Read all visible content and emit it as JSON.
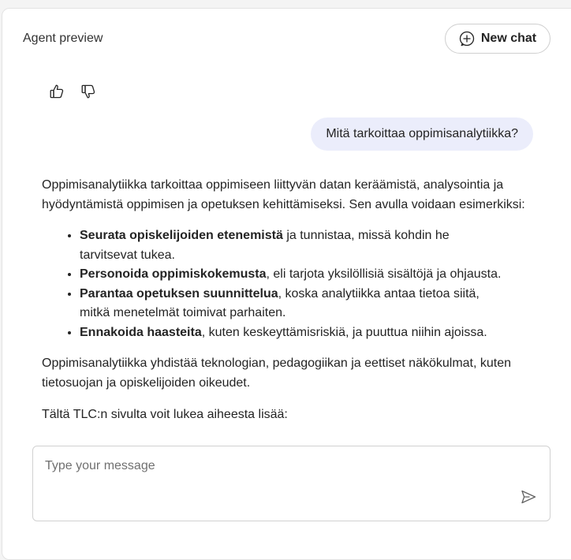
{
  "header": {
    "title": "Agent preview",
    "new_chat_label": "New chat"
  },
  "feedback": {
    "thumbs_up_icon": "thumbs-up-icon",
    "thumbs_down_icon": "thumbs-down-icon"
  },
  "conversation": {
    "user_message": "Mitä tarkoittaa oppimisanalytiikka?",
    "reply": {
      "intro": "Oppimisanalytiikka tarkoittaa oppimiseen liittyvän datan keräämistä, analysointia ja hyödyntämistä oppimisen ja opetuksen kehittämiseksi. Sen avulla voidaan esimerkiksi:",
      "bullets": [
        {
          "bold": "Seurata opiskelijoiden etenemistä",
          "rest": " ja tunnistaa, missä kohdin he tarvitsevat tukea."
        },
        {
          "bold": "Personoida oppimiskokemusta",
          "rest": ", eli tarjota yksilöllisiä sisältöjä ja ohjausta."
        },
        {
          "bold": "Parantaa opetuksen suunnittelua",
          "rest": ", koska analytiikka antaa tietoa siitä, mitkä menetelmät toimivat parhaiten."
        },
        {
          "bold": "Ennakoida haasteita",
          "rest": ", kuten keskeyttämisriskiä, ja puuttua niihin ajoissa."
        }
      ],
      "outro": "Oppimisanalytiikka yhdistää teknologian, pedagogiikan ja eettiset näkökulmat, kuten tietosuojan ja opiskelijoiden oikeudet.",
      "more": "Tältä TLC:n sivulta voit lukea aiheesta lisää:"
    }
  },
  "composer": {
    "placeholder": "Type your message",
    "value": "",
    "send_icon": "send-icon"
  },
  "colors": {
    "user_bubble_bg": "#ebedfb",
    "text": "#242424",
    "border": "#d1d1d1"
  }
}
